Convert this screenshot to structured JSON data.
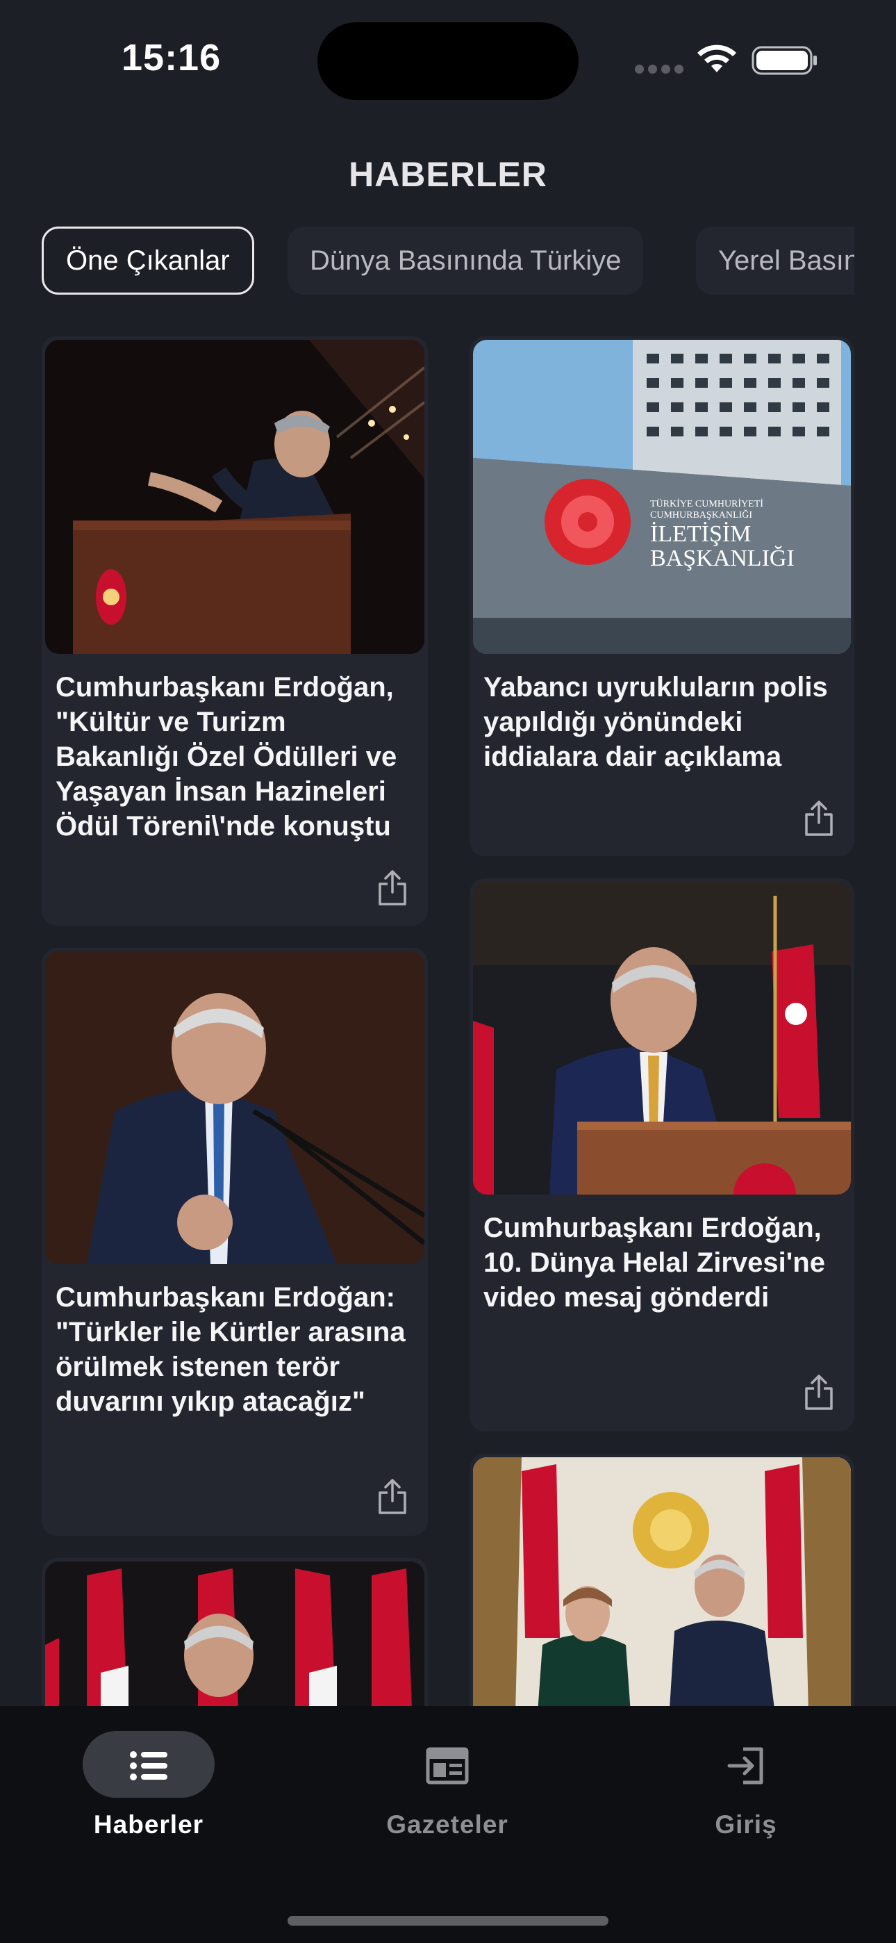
{
  "status": {
    "time": "15:16"
  },
  "header": {
    "title": "HABERLER"
  },
  "tabs": [
    {
      "label": "Öne Çıkanlar",
      "active": true
    },
    {
      "label": "Dünya Basınında Türkiye",
      "active": false
    },
    {
      "label": "Yerel Basın",
      "active": false
    }
  ],
  "cards": [
    {
      "title": "Cumhurbaşkanı Erdoğan, \"Kültür ve Turizm Bakanlığı Özel Ödülleri ve Yaşayan İnsan Hazineleri Ödül Töreni\\'nde konuştu",
      "image": "erdogan-podium-ceremony"
    },
    {
      "title": "Yabancı uyrukluların polis yapıldığı yönündeki iddialara dair açıklama",
      "image": "iletisim-baskanligi-building",
      "image_text": [
        "TÜRKİYE CUMHURİYETİ",
        "CUMHURBAŞKANLIĞI",
        "İLETİŞİM",
        "BAŞKANLIĞI"
      ]
    },
    {
      "title": "Cumhurbaşkanı Erdoğan: \"Türkler ile Kürtler arasına örülmek istenen terör duvarını yıkıp atacağız\"",
      "image": "erdogan-speech-microphones"
    },
    {
      "title": "Cumhurbaşkanı Erdoğan, 10. Dünya Helal Zirvesi'ne video mesaj gönderdi",
      "image": "erdogan-flags-podium"
    },
    {
      "title": "",
      "image": "erdogan-flags-partial"
    },
    {
      "title": "",
      "image": "erdogan-meeting-guest"
    }
  ],
  "share_icon": "share-icon",
  "tabbar": {
    "items": [
      {
        "label": "Haberler",
        "icon": "list-icon",
        "active": true
      },
      {
        "label": "Gazeteler",
        "icon": "newspaper-icon",
        "active": false
      },
      {
        "label": "Giriş",
        "icon": "login-icon",
        "active": false
      }
    ]
  },
  "colors": {
    "background": "#1d1f26",
    "card": "#23262e",
    "tabbar": "#0e0f12",
    "accent_red": "#d3232a"
  }
}
